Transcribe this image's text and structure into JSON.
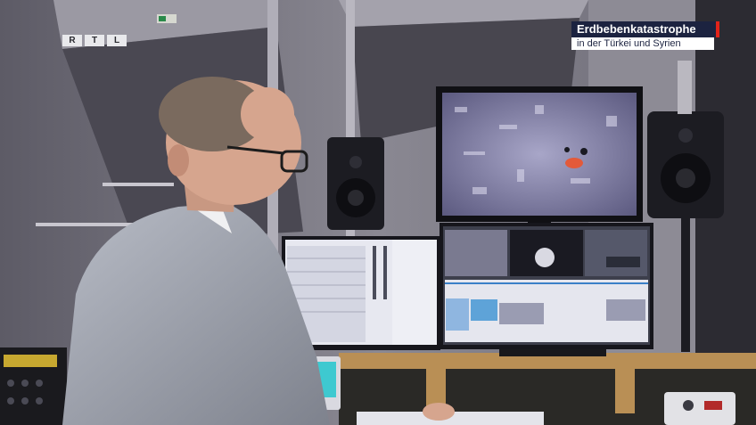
{
  "broadcaster": {
    "logo_letters": [
      "R",
      "T",
      "L"
    ]
  },
  "lower_third": {
    "title": "Erdbebenkatastrophe",
    "subtitle": "in der Türkei und Syrien",
    "accent_color": "#e2231a",
    "title_bg": "#1c2340"
  }
}
